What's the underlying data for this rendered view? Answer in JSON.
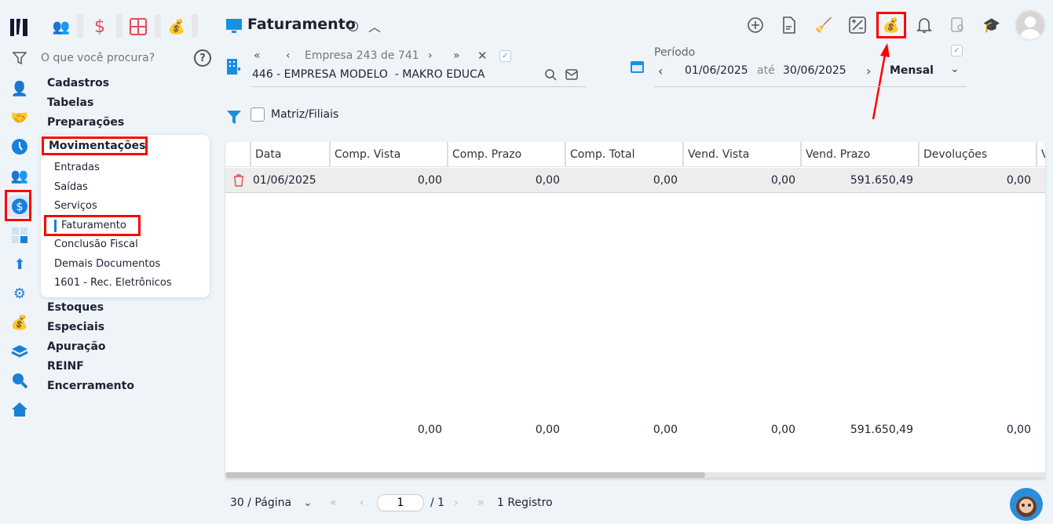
{
  "app": {
    "top_icons": [
      "users-icon",
      "dollar-icon",
      "calculator-icon",
      "money-bag-icon"
    ]
  },
  "search": {
    "placeholder": "O que você procura?"
  },
  "menu": {
    "items": [
      "Cadastros",
      "Tabelas",
      "Preparações",
      "Movimentações",
      "Estoques",
      "Especiais",
      "Apuração",
      "REINF",
      "Encerramento"
    ],
    "submenu": [
      "Entradas",
      "Saídas",
      "Serviços",
      "Faturamento",
      "Conclusão Fiscal",
      "Demais Documentos",
      "1601 - Rec. Eletrônicos"
    ],
    "active_item": "Movimentações",
    "active_sub": "Faturamento"
  },
  "header": {
    "title": "Faturamento",
    "toolbar_icons": [
      "add-icon",
      "document-icon",
      "broom-icon",
      "percent-icon",
      "money-bag-icon",
      "bell-icon",
      "report-search-icon",
      "graduation-cap-icon"
    ]
  },
  "empresa": {
    "nav_label": "Empresa",
    "current": "243",
    "of": "de",
    "total": "741",
    "name": "446 - EMPRESA MODELO  - MAKRO EDUCA"
  },
  "periodo": {
    "label": "Período",
    "start": "01/06/2025",
    "until": "até",
    "end": "30/06/2025",
    "type": "Mensal"
  },
  "filter": {
    "matriz_label": "Matriz/Filiais",
    "checked": false
  },
  "table": {
    "columns": [
      "Data",
      "Comp. Vista",
      "Comp. Prazo",
      "Comp. Total",
      "Vend. Vista",
      "Vend. Prazo",
      "Devoluções",
      "V"
    ],
    "rows": [
      {
        "date": "01/06/2025",
        "values": [
          "0,00",
          "0,00",
          "0,00",
          "0,00",
          "591.650,49",
          "0,00"
        ]
      }
    ],
    "totals": [
      "0,00",
      "0,00",
      "0,00",
      "0,00",
      "591.650,49",
      "0,00"
    ]
  },
  "pagination": {
    "per_page": "30 / Página",
    "page": "1",
    "of_pages": "/ 1",
    "records": "1 Registro"
  },
  "colors": {
    "accent": "#1a7fd8",
    "highlight": "#ff0000",
    "top_icons": "#e84b55"
  }
}
